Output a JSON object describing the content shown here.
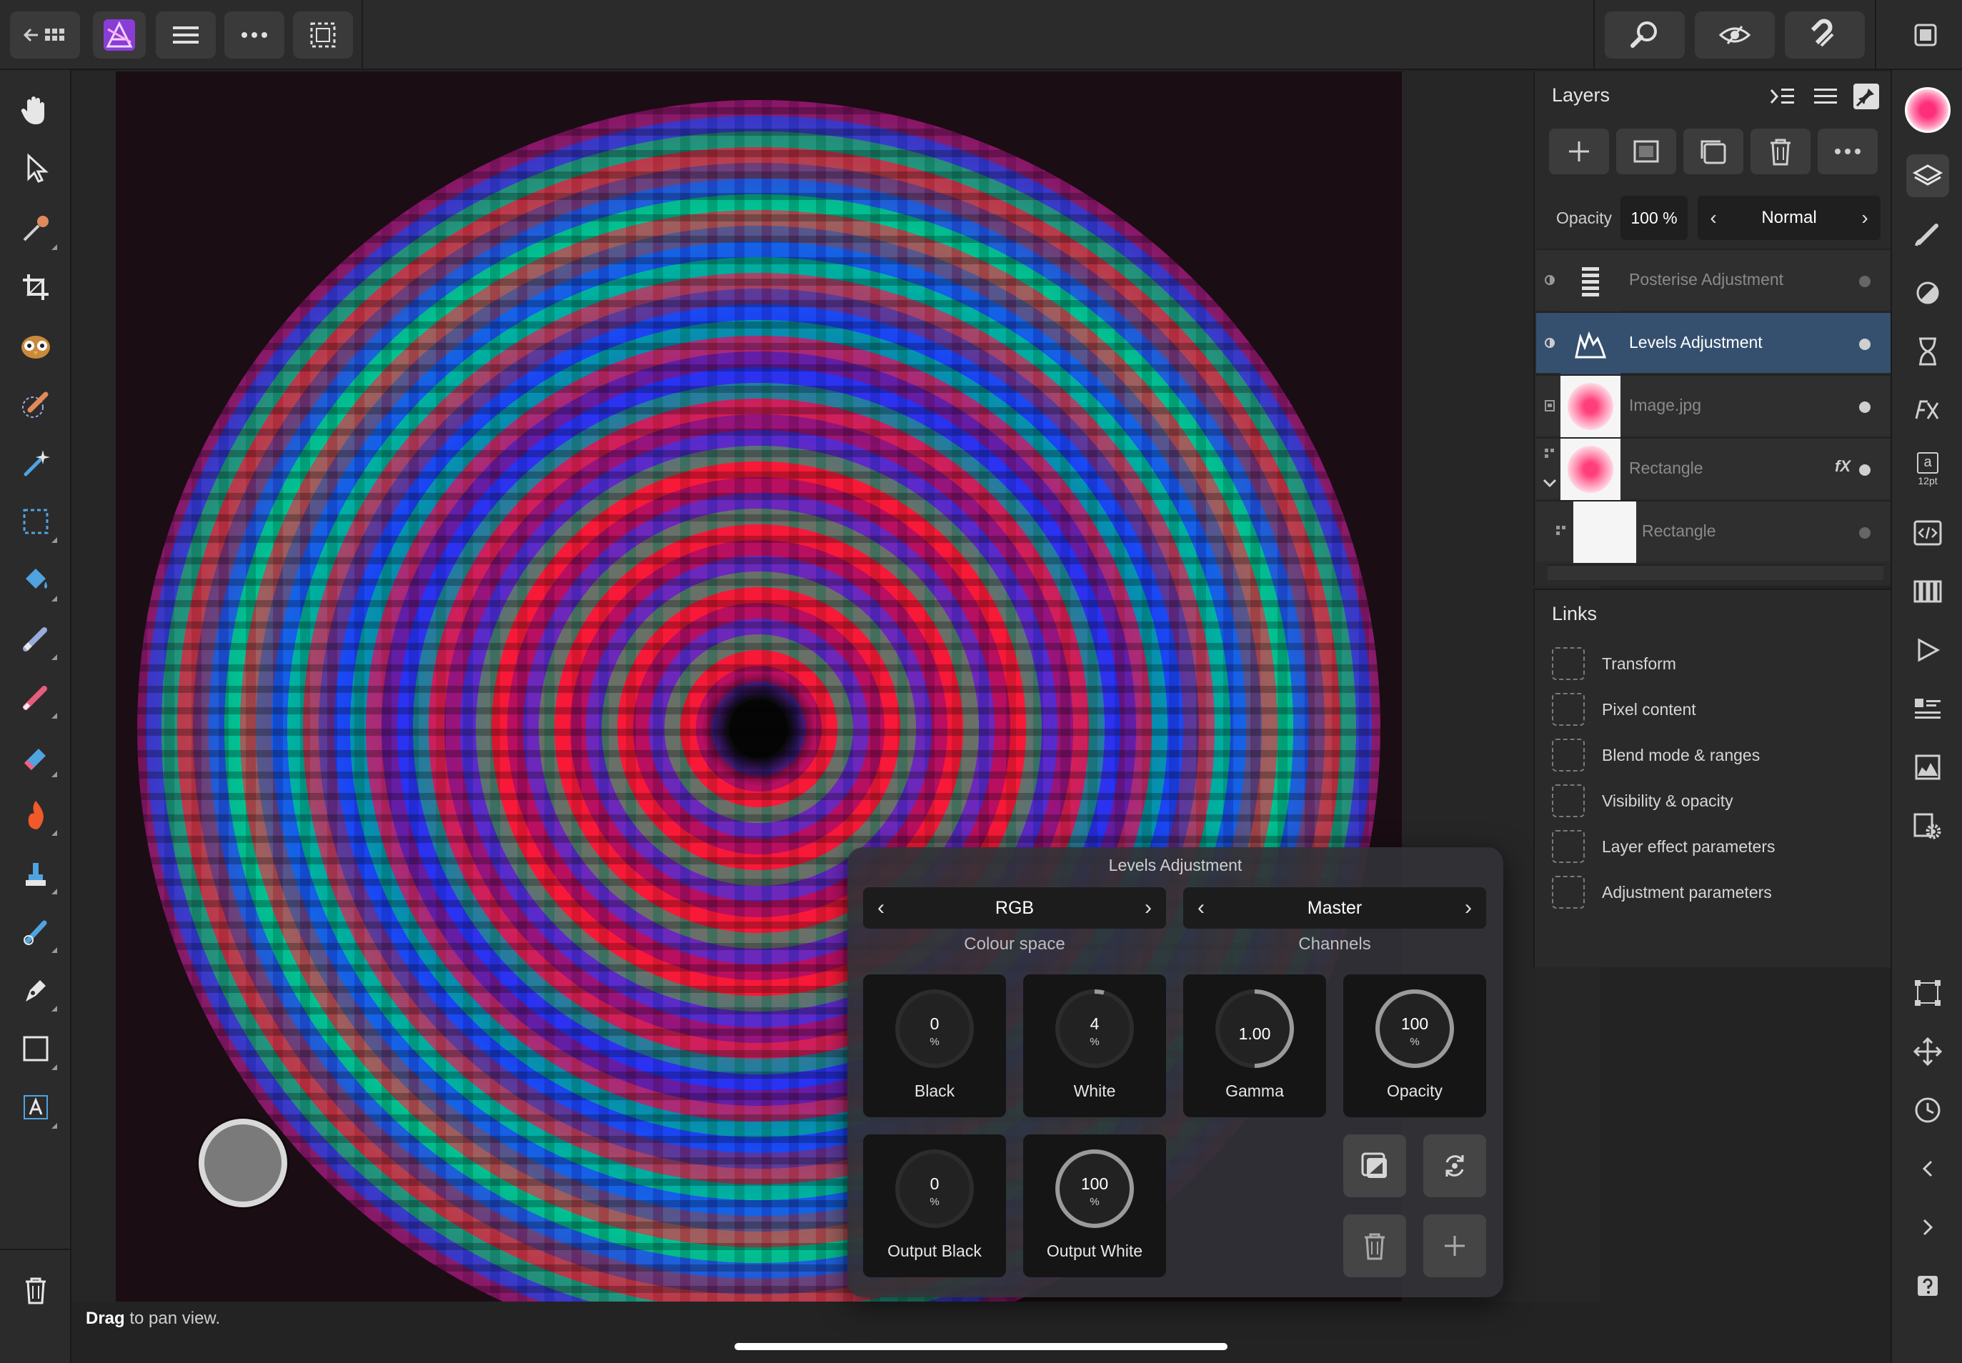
{
  "canvas": {
    "status_prefix": "Drag",
    "status_suffix": " to pan view."
  },
  "levels": {
    "title": "Levels Adjustment",
    "colour_space": {
      "value": "RGB",
      "caption": "Colour space"
    },
    "channels": {
      "value": "Master",
      "caption": "Channels"
    },
    "dials": [
      {
        "label": "Black",
        "value": "0",
        "unit": "%",
        "fraction": 0.0
      },
      {
        "label": "White",
        "value": "4",
        "unit": "%",
        "fraction": 0.04
      },
      {
        "label": "Gamma",
        "value": "1.00",
        "unit": "",
        "fraction": 0.5
      },
      {
        "label": "Opacity",
        "value": "100",
        "unit": "%",
        "fraction": 1.0
      },
      {
        "label": "Output Black",
        "value": "0",
        "unit": "%",
        "fraction": 0.0
      },
      {
        "label": "Output White",
        "value": "100",
        "unit": "%",
        "fraction": 1.0
      }
    ]
  },
  "layers": {
    "title": "Layers",
    "opacity_label": "Opacity",
    "opacity_value": "100 %",
    "blend_mode": "Normal",
    "items": [
      {
        "name": "Posterise Adjustment",
        "selected": false
      },
      {
        "name": "Levels Adjustment",
        "selected": true
      },
      {
        "name": "Image.jpg",
        "selected": false
      },
      {
        "name": "Rectangle",
        "selected": false,
        "fx": "fX"
      },
      {
        "name": "Rectangle",
        "selected": false
      }
    ]
  },
  "links": {
    "title": "Links",
    "items": [
      "Transform",
      "Pixel content",
      "Blend mode & ranges",
      "Visibility & opacity",
      "Layer effect parameters",
      "Adjustment parameters"
    ]
  },
  "rightbar": {
    "text_tool_label": "a",
    "text_tool_size": "12pt"
  },
  "colors": {
    "accent_selected": "#35506f",
    "panel": "#2a2a2a",
    "toolbar": "#2b2b2b"
  }
}
